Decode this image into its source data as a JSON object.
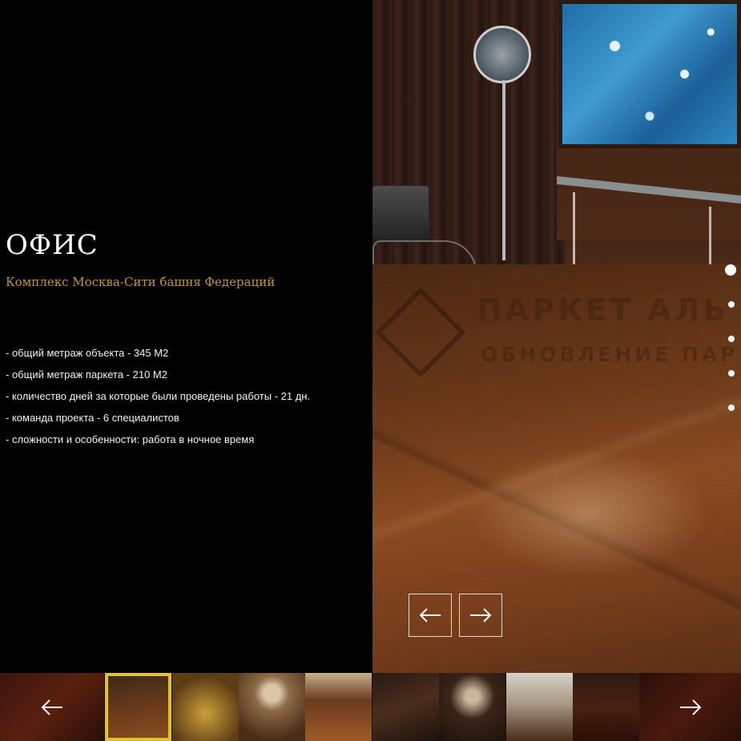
{
  "project": {
    "title": "ОФИС",
    "subtitle": "Комплекс Москва-Сити башня Федераций",
    "facts": [
      "- общий метраж объекта - 345 М2",
      "- общий метраж паркета - 210 М2",
      "- количество дней за которые были проведены работы - 21 дн.",
      "- команда проекта - 6 специалистов",
      "- сложности и особенности: работа в ночное время"
    ]
  },
  "photo": {
    "watermark": "ПАРКЕТ АЛЬ",
    "watermark_sub": "ОБНОВЛЕНИЕ ПАР"
  },
  "pagination": {
    "count": 5,
    "active_index": 0
  },
  "slider": {
    "prev_icon": "arrow-left-icon",
    "next_icon": "arrow-right-icon"
  },
  "thumbnails": {
    "count": 8,
    "active_index": 0,
    "accent_color": "#e3c22a"
  },
  "colors": {
    "subtitle": "#c9952f",
    "background": "#000000"
  }
}
